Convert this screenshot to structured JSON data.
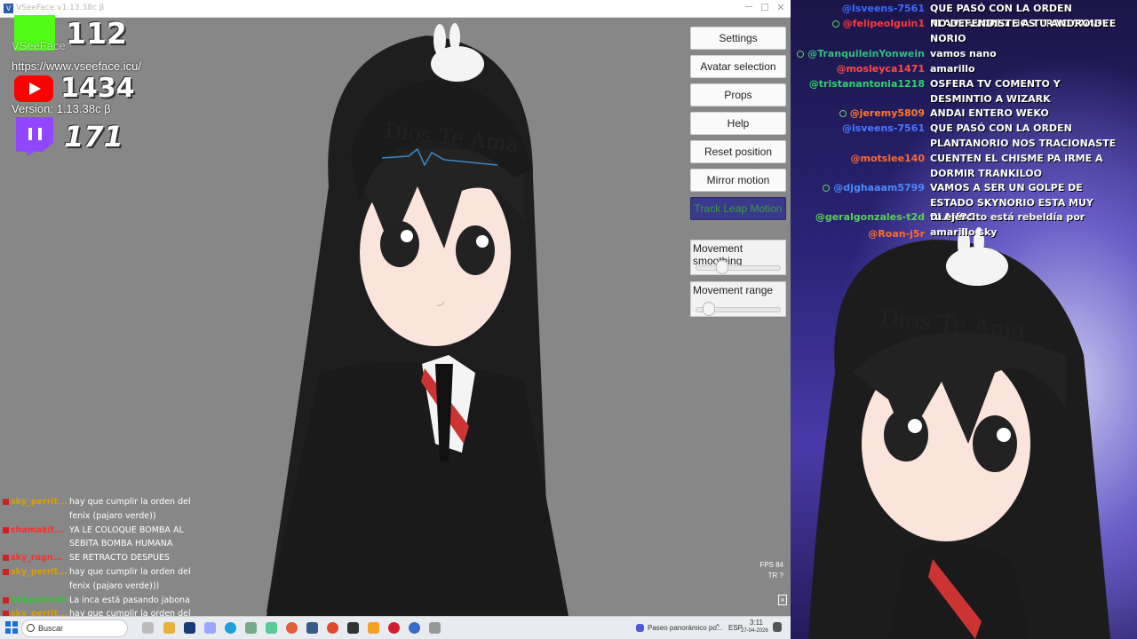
{
  "window": {
    "title": "VSeeFace v1.13.38c β",
    "minimize_glyph": "─",
    "maximize_glyph": "☐",
    "close_glyph": "✕",
    "app_icon_glyph": "V"
  },
  "info": {
    "app_name": "VSeeFace",
    "url": "https://www.vseeface.icu/",
    "version": "Version: 1.13.38c β"
  },
  "stats": {
    "kick": "112",
    "youtube": "1434",
    "twitch": "171"
  },
  "panel": {
    "buttons": [
      "Settings",
      "Avatar selection",
      "Props",
      "Help",
      "Reset position",
      "Mirror motion",
      "Track Leap Motion"
    ],
    "sliders": [
      {
        "label": "Movement smoothing",
        "value": 0.28
      },
      {
        "label": "Movement range",
        "value": 0.1
      }
    ],
    "fps": "FPS 84",
    "tr": "TR  ?"
  },
  "avatar": {
    "headband_text": "Dios Te Ama"
  },
  "left_chat": [
    {
      "user": "sky_perrit...",
      "user_color": "#d6a000",
      "msg": "hay que cumplir la orden del fenix (pajaro verde))"
    },
    {
      "user": "chamakit...",
      "user_color": "#ff2d2d",
      "msg": "YA LE COLOQUE BOMBA AL SEBITA BOMBA HUMANA"
    },
    {
      "user": "sky_ragn...",
      "user_color": "#ff2d2d",
      "msg": "SE RETRACTO DESPUES"
    },
    {
      "user": "sky_perrit...",
      "user_color": "#d6a000",
      "msg": "hay que cumplir la orden del fenix (pajaro verde)))"
    },
    {
      "user": "b0bpatricl0",
      "user_color": "#36c436",
      "msg": "La inca está pasando jabona"
    },
    {
      "user": "sky_perrit...",
      "user_color": "#d6a000",
      "msg": "hay que cumplir la orden del"
    }
  ],
  "right_chat": [
    {
      "user": "@Isveens-7561",
      "color": "#3a6bff",
      "msg": "QUE PASÓ CON LA ORDEN PLANTANORIO NOS TRACIONASTE",
      "badge": false
    },
    {
      "user": "@felipeolguin1",
      "color": "#ff3a3a",
      "msg": "NO DEFENDISTE A TU ANDROIDE NORIO",
      "badge": true
    },
    {
      "user": "@TranquileinYonwein",
      "color": "#2fc07a",
      "msg": "vamos nano",
      "badge": true
    },
    {
      "user": "@mosleyca1471",
      "color": "#ff4a4a",
      "msg": "amarillo",
      "badge": false
    },
    {
      "user": "@tristanantonia1218",
      "color": "#2fd46a",
      "msg": "OSFERA TV COMENTO Y DESMINTIO A WIZARK",
      "badge": false
    },
    {
      "user": "@jeremy5809",
      "color": "#ff7a30",
      "msg": "ANDAI ENTERO WEKO",
      "badge": true
    },
    {
      "user": "@isveens-7561",
      "color": "#4a7aff",
      "msg": "QUE PASÓ CON LA ORDEN PLANTANORIO NOS TRACIONASTE",
      "badge": false
    },
    {
      "user": "@motslee140",
      "color": "#ff6a30",
      "msg": "CUENTEN EL CHISME PA IRME A DORMIR TRANKILOO",
      "badge": false
    },
    {
      "user": "@djghaaam5799",
      "color": "#4a8aff",
      "msg": "VAMOS A SER UN GOLPE DE ESTADO SKYNORIO ESTA MUY BLANDO",
      "badge": true
    },
    {
      "user": "@geralgonzales-t2d",
      "color": "#5ad05a",
      "msg": "tu ejército está rebeldía por amarillo sky",
      "badge": false
    },
    {
      "user": "@Roan-j5r",
      "color": "#ff6a30",
      "msg": "",
      "badge": false
    }
  ],
  "taskbar": {
    "search_placeholder": "Buscar",
    "window_label": "Paseo panorámico po...",
    "lang": "ESP",
    "time": "3:11",
    "date": "27-04-2026"
  }
}
